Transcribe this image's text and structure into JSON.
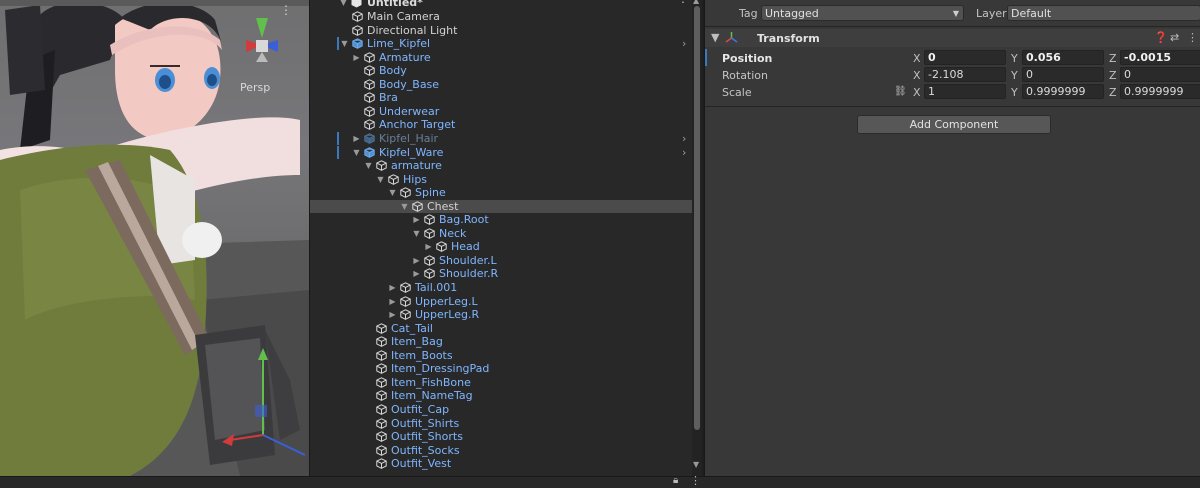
{
  "scene": {
    "persp_label": "Persp",
    "gizmo_y": "y"
  },
  "hierarchy": {
    "scene_title": "Untitled*",
    "rows": [
      {
        "label": "Main Camera",
        "depth": 0,
        "arrow": "",
        "color": "white",
        "selected": false,
        "bar": false,
        "chevron": false,
        "icon": "camera-cube"
      },
      {
        "label": "Directional Light",
        "depth": 0,
        "arrow": "",
        "color": "white",
        "selected": false,
        "bar": false,
        "chevron": false,
        "icon": "light-cube"
      },
      {
        "label": "Lime_Kipfel",
        "depth": 0,
        "arrow": "down",
        "color": "blue",
        "selected": false,
        "bar": true,
        "chevron": true,
        "icon": "prefab-cube"
      },
      {
        "label": "Armature",
        "depth": 1,
        "arrow": "right",
        "color": "blue",
        "selected": false,
        "bar": false,
        "chevron": false,
        "icon": "cube"
      },
      {
        "label": "Body",
        "depth": 1,
        "arrow": "",
        "color": "blue",
        "selected": false,
        "bar": false,
        "chevron": false,
        "icon": "cube"
      },
      {
        "label": "Body_Base",
        "depth": 1,
        "arrow": "",
        "color": "blue",
        "selected": false,
        "bar": false,
        "chevron": false,
        "icon": "cube"
      },
      {
        "label": "Bra",
        "depth": 1,
        "arrow": "",
        "color": "blue",
        "selected": false,
        "bar": false,
        "chevron": false,
        "icon": "cube"
      },
      {
        "label": "Underwear",
        "depth": 1,
        "arrow": "",
        "color": "blue",
        "selected": false,
        "bar": false,
        "chevron": false,
        "icon": "cube"
      },
      {
        "label": "Anchor Target",
        "depth": 1,
        "arrow": "",
        "color": "blue",
        "selected": false,
        "bar": false,
        "chevron": false,
        "icon": "cube"
      },
      {
        "label": "Kipfel_Hair",
        "depth": 1,
        "arrow": "right",
        "color": "dim",
        "selected": false,
        "bar": true,
        "chevron": true,
        "icon": "prefab-cube"
      },
      {
        "label": "Kipfel_Ware",
        "depth": 1,
        "arrow": "down",
        "color": "blue",
        "selected": false,
        "bar": true,
        "chevron": true,
        "icon": "prefab-cube"
      },
      {
        "label": "armature",
        "depth": 2,
        "arrow": "down",
        "color": "blue",
        "selected": false,
        "bar": false,
        "chevron": false,
        "icon": "cube"
      },
      {
        "label": "Hips",
        "depth": 3,
        "arrow": "down",
        "color": "blue",
        "selected": false,
        "bar": false,
        "chevron": false,
        "icon": "cube"
      },
      {
        "label": "Spine",
        "depth": 4,
        "arrow": "down",
        "color": "blue",
        "selected": false,
        "bar": false,
        "chevron": false,
        "icon": "cube"
      },
      {
        "label": "Chest",
        "depth": 5,
        "arrow": "down",
        "color": "white",
        "selected": true,
        "bar": false,
        "chevron": false,
        "icon": "cube"
      },
      {
        "label": "Bag.Root",
        "depth": 6,
        "arrow": "right",
        "color": "blue",
        "selected": false,
        "bar": false,
        "chevron": false,
        "icon": "cube"
      },
      {
        "label": "Neck",
        "depth": 6,
        "arrow": "down",
        "color": "blue",
        "selected": false,
        "bar": false,
        "chevron": false,
        "icon": "cube"
      },
      {
        "label": "Head",
        "depth": 7,
        "arrow": "right",
        "color": "blue",
        "selected": false,
        "bar": false,
        "chevron": false,
        "icon": "cube"
      },
      {
        "label": "Shoulder.L",
        "depth": 6,
        "arrow": "right",
        "color": "blue",
        "selected": false,
        "bar": false,
        "chevron": false,
        "icon": "cube"
      },
      {
        "label": "Shoulder.R",
        "depth": 6,
        "arrow": "right",
        "color": "blue",
        "selected": false,
        "bar": false,
        "chevron": false,
        "icon": "cube"
      },
      {
        "label": "Tail.001",
        "depth": 4,
        "arrow": "right",
        "color": "blue",
        "selected": false,
        "bar": false,
        "chevron": false,
        "icon": "cube"
      },
      {
        "label": "UpperLeg.L",
        "depth": 4,
        "arrow": "right",
        "color": "blue",
        "selected": false,
        "bar": false,
        "chevron": false,
        "icon": "cube"
      },
      {
        "label": "UpperLeg.R",
        "depth": 4,
        "arrow": "right",
        "color": "blue",
        "selected": false,
        "bar": false,
        "chevron": false,
        "icon": "cube"
      },
      {
        "label": "Cat_Tail",
        "depth": 2,
        "arrow": "",
        "color": "blue",
        "selected": false,
        "bar": false,
        "chevron": false,
        "icon": "cube"
      },
      {
        "label": "Item_Bag",
        "depth": 2,
        "arrow": "",
        "color": "blue",
        "selected": false,
        "bar": false,
        "chevron": false,
        "icon": "cube"
      },
      {
        "label": "Item_Boots",
        "depth": 2,
        "arrow": "",
        "color": "blue",
        "selected": false,
        "bar": false,
        "chevron": false,
        "icon": "cube"
      },
      {
        "label": "Item_DressingPad",
        "depth": 2,
        "arrow": "",
        "color": "blue",
        "selected": false,
        "bar": false,
        "chevron": false,
        "icon": "cube"
      },
      {
        "label": "Item_FishBone",
        "depth": 2,
        "arrow": "",
        "color": "blue",
        "selected": false,
        "bar": false,
        "chevron": false,
        "icon": "cube"
      },
      {
        "label": "Item_NameTag",
        "depth": 2,
        "arrow": "",
        "color": "blue",
        "selected": false,
        "bar": false,
        "chevron": false,
        "icon": "cube"
      },
      {
        "label": "Outfit_Cap",
        "depth": 2,
        "arrow": "",
        "color": "blue",
        "selected": false,
        "bar": false,
        "chevron": false,
        "icon": "cube"
      },
      {
        "label": "Outfit_Shirts",
        "depth": 2,
        "arrow": "",
        "color": "blue",
        "selected": false,
        "bar": false,
        "chevron": false,
        "icon": "cube"
      },
      {
        "label": "Outfit_Shorts",
        "depth": 2,
        "arrow": "",
        "color": "blue",
        "selected": false,
        "bar": false,
        "chevron": false,
        "icon": "cube"
      },
      {
        "label": "Outfit_Socks",
        "depth": 2,
        "arrow": "",
        "color": "blue",
        "selected": false,
        "bar": false,
        "chevron": false,
        "icon": "cube"
      },
      {
        "label": "Outfit_Vest",
        "depth": 2,
        "arrow": "",
        "color": "blue",
        "selected": false,
        "bar": false,
        "chevron": false,
        "icon": "cube"
      }
    ]
  },
  "inspector": {
    "tag_label": "Tag",
    "tag_value": "Untagged",
    "layer_label": "Layer",
    "layer_value": "Default",
    "transform_title": "Transform",
    "position": {
      "label": "Position",
      "x": "0",
      "y": "0.056",
      "z": "-0.0015"
    },
    "rotation": {
      "label": "Rotation",
      "x": "-2.108",
      "y": "0",
      "z": "0"
    },
    "scale": {
      "label": "Scale",
      "x": "1",
      "y": "0.9999999",
      "z": "0.9999999"
    },
    "axis_x": "X",
    "axis_y": "Y",
    "axis_z": "Z",
    "add_component": "Add Component"
  },
  "colors": {
    "accent_blue": "#3a79bb",
    "prefab_text": "#7fb6ff",
    "selection": "#4b4b4b"
  }
}
